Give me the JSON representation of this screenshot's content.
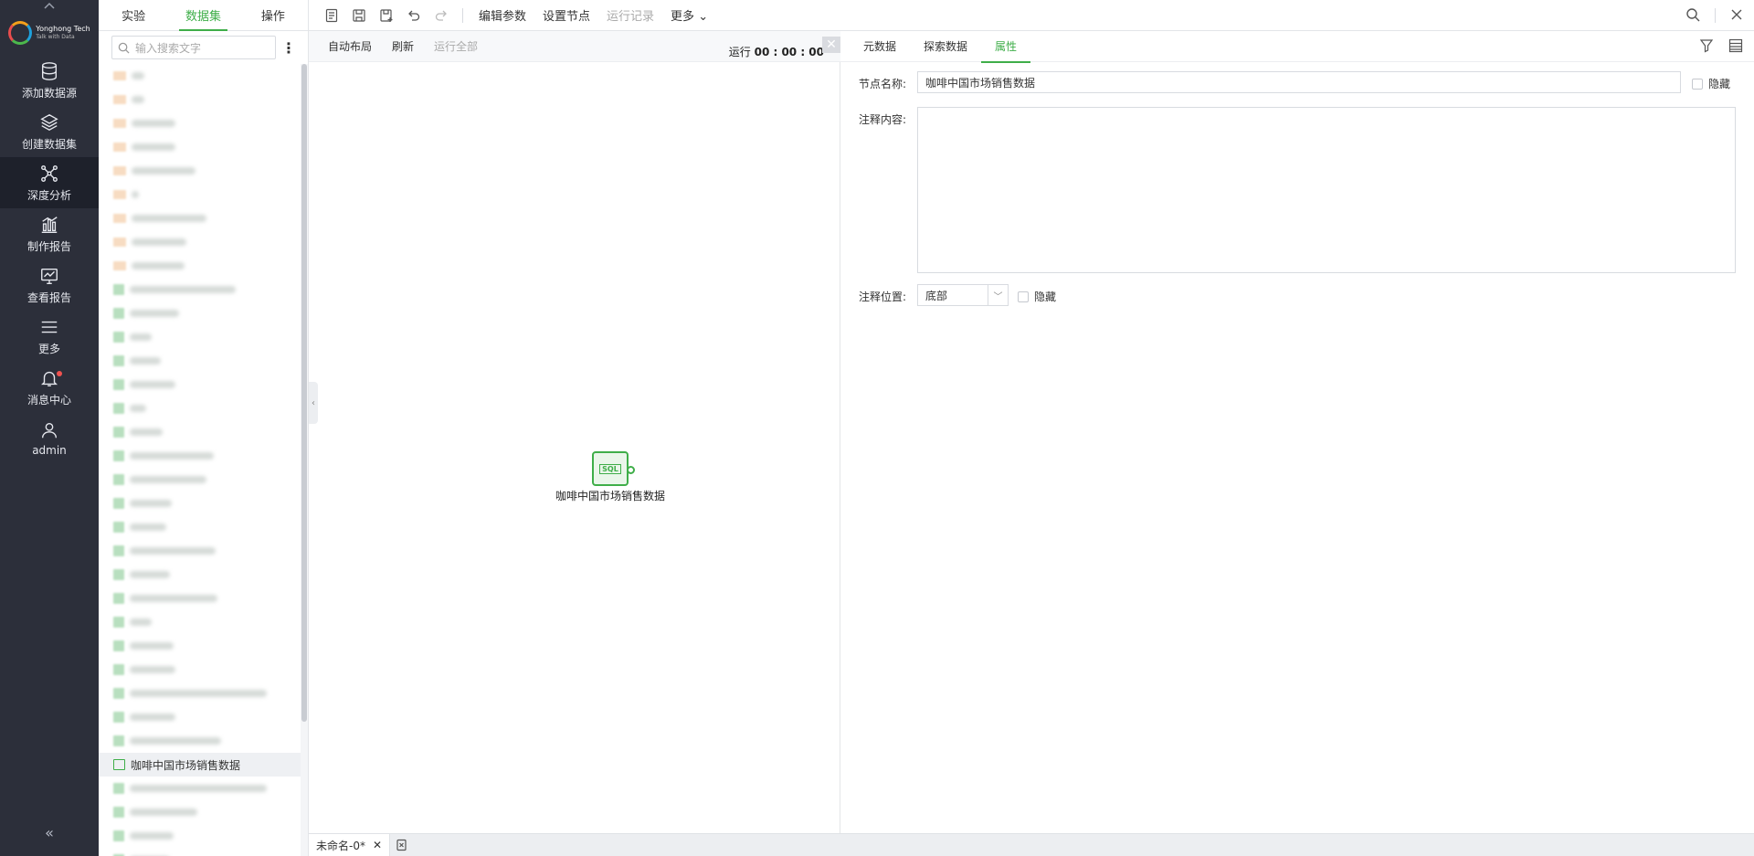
{
  "logo": {
    "name": "Yonghong Tech",
    "tagline": "Talk with Data"
  },
  "nav": {
    "items": [
      {
        "label": "添加数据源",
        "icon": "database-icon"
      },
      {
        "label": "创建数据集",
        "icon": "layers-icon"
      },
      {
        "label": "深度分析",
        "icon": "graph-nodes-icon",
        "active": true
      },
      {
        "label": "制作报告",
        "icon": "bar-chart-icon"
      },
      {
        "label": "查看报告",
        "icon": "monitor-chart-icon"
      },
      {
        "label": "更多",
        "icon": "menu-icon"
      },
      {
        "label": "消息中心",
        "icon": "bell-icon",
        "badge": true
      },
      {
        "label": "admin",
        "icon": "user-icon"
      }
    ],
    "collapse": "«"
  },
  "dataset_panel": {
    "tabs": [
      "实验",
      "数据集",
      "操作"
    ],
    "active_tab": "数据集",
    "search_placeholder": "输入搜索文字",
    "selected_item": "咖啡中国市场销售数据"
  },
  "toolbar": {
    "buttons": [
      "编辑参数",
      "设置节点",
      "运行记录",
      "更多"
    ],
    "more_caret": "⌄"
  },
  "canvas_bar": {
    "auto_layout": "自动布局",
    "refresh": "刷新",
    "run_all": "运行全部",
    "run_label": "运行",
    "run_time": "00 : 00 : 00"
  },
  "node": {
    "label": "咖啡中国市场销售数据",
    "badge": "SQL"
  },
  "bottom_tabs": {
    "tab_label": "未命名-0*"
  },
  "properties": {
    "tabs": [
      "元数据",
      "探索数据",
      "属性"
    ],
    "active_tab": "属性",
    "node_name_label": "节点名称:",
    "node_name_value": "咖啡中国市场销售数据",
    "hide_label": "隐藏",
    "comment_label": "注释内容:",
    "comment_value": "",
    "comment_position_label": "注释位置:",
    "comment_position_value": "底部",
    "hide_label_2": "隐藏"
  }
}
